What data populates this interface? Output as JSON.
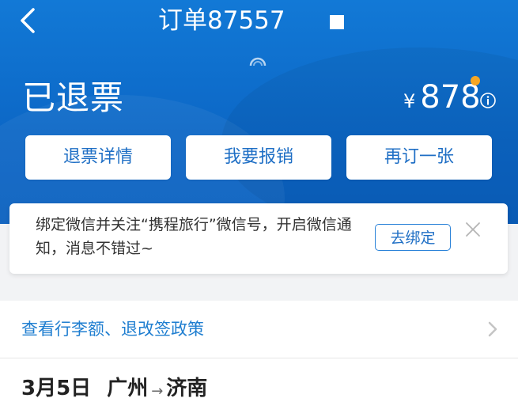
{
  "header": {
    "order_title": "订单87557",
    "status": "已退票",
    "price_currency": "¥",
    "price_amount": "878"
  },
  "actions": {
    "refund_details": "退票详情",
    "reimburse": "我要报销",
    "rebook": "再订一张"
  },
  "wechat_bind": {
    "message": "绑定微信并关注“携程旅行”微信号，开启微信通知，消息不错过~",
    "button": "去绑定"
  },
  "policy": {
    "label": "查看行李额、退改签政策"
  },
  "trip": {
    "date": "3月5日",
    "from": "广州",
    "arrow": "→",
    "to": "济南"
  },
  "colors": {
    "header_blue": "#0c67c6",
    "accent_blue": "#1f6fc5",
    "badge_orange": "#f6a623"
  }
}
